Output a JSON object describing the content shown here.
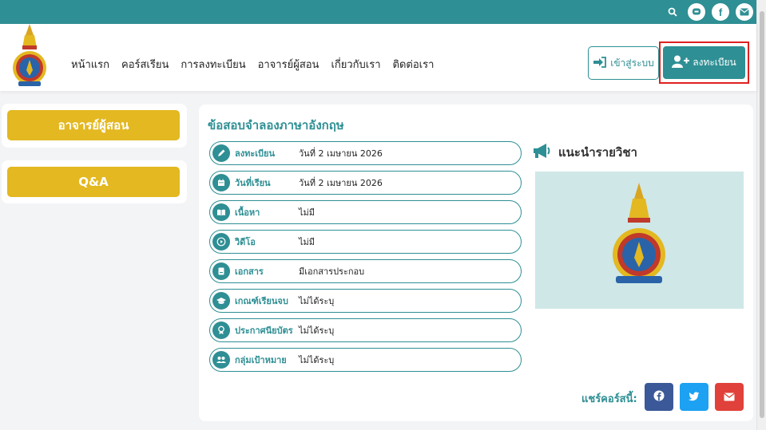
{
  "header": {
    "nav": [
      "หน้าแรก",
      "คอร์สเรียน",
      "การลงทะเบียน",
      "อาจารย์ผู้สอน",
      "เกี่ยวกับเรา",
      "ติดต่อเรา"
    ],
    "login_label": "เข้าสู่ระบบ",
    "register_label": "ลงทะเบียน"
  },
  "sidebar": {
    "teachers_label": "อาจารย์ผู้สอน",
    "qa_label": "Q&A"
  },
  "course": {
    "title": "ข้อสอบจำลองภาษาอังกฤษ",
    "rows": [
      {
        "icon": "pencil-icon",
        "label": "ลงทะเบียน",
        "value": "วันที่ 2 เมษายน 2026"
      },
      {
        "icon": "calendar-icon",
        "label": "วันที่เรียน",
        "value": "วันที่ 2 เมษายน 2026"
      },
      {
        "icon": "book-icon",
        "label": "เนื้อหา",
        "value": "ไม่มี"
      },
      {
        "icon": "play-icon",
        "label": "วิดีโอ",
        "value": "ไม่มี"
      },
      {
        "icon": "document-icon",
        "label": "เอกสาร",
        "value": "มีเอกสารประกอบ"
      },
      {
        "icon": "graduation-cap-icon",
        "label": "เกณฑ์เรียนจบ",
        "value": "ไม่ได้ระบุ"
      },
      {
        "icon": "certificate-icon",
        "label": "ประกาศนียบัตร",
        "value": "ไม่ได้ระบุ"
      },
      {
        "icon": "users-icon",
        "label": "กลุ่มเป้าหมาย",
        "value": "ไม่ได้ระบุ"
      }
    ],
    "intro_title": "แนะนำรายวิชา",
    "share_label": "แชร์คอร์สนี้:"
  },
  "colors": {
    "primary": "#2e8f94",
    "gold": "#e3b820",
    "facebook": "#3b5998",
    "twitter": "#1da1f2",
    "email": "#e0413a"
  }
}
